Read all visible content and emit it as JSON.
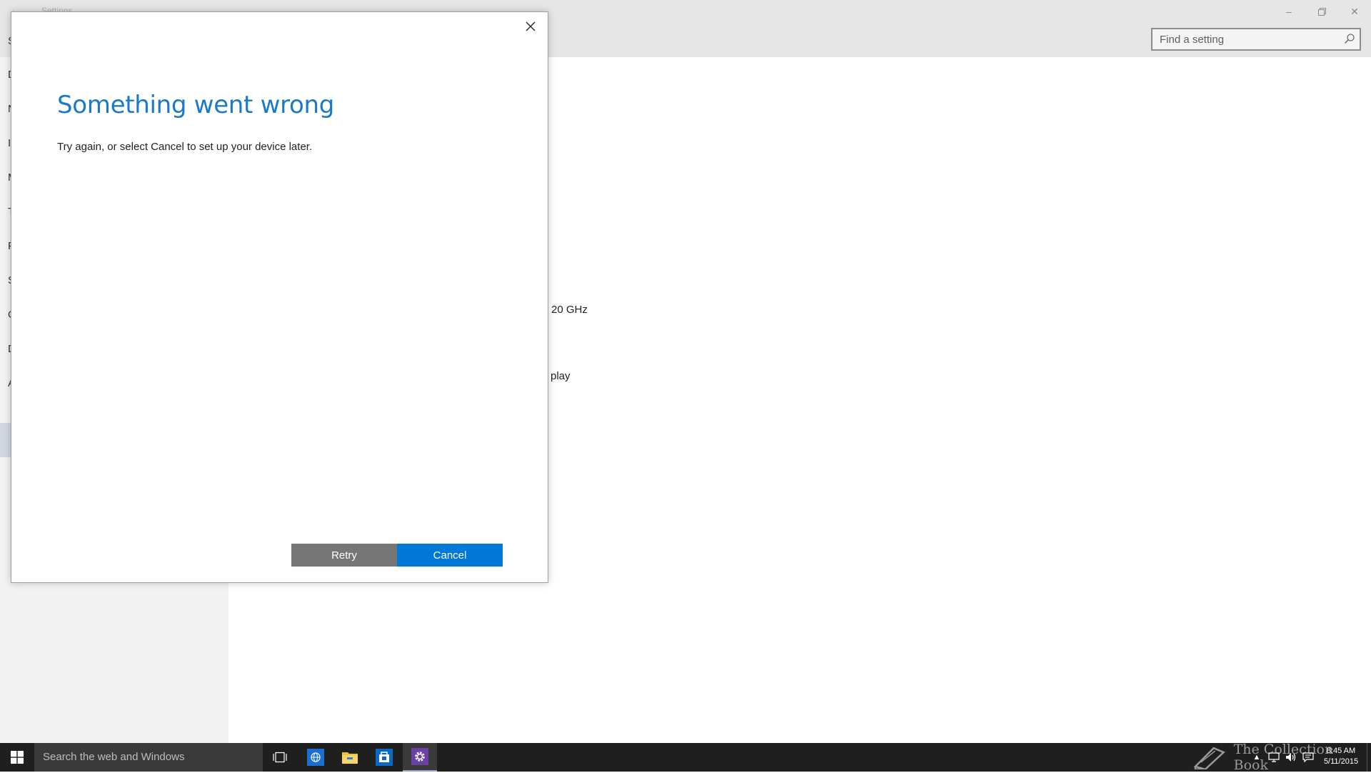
{
  "window": {
    "title": "Settings",
    "search": {
      "placeholder": "Find a setting"
    },
    "sidebar_letters": [
      "S",
      "D",
      "N",
      "I",
      "M",
      "T",
      "P",
      "S",
      "O",
      "D",
      "A"
    ],
    "content_fragments": [
      "20 GHz",
      "play"
    ]
  },
  "dialog": {
    "title": "Something went wrong",
    "message": "Try again, or select Cancel to set up your device later.",
    "retry_label": "Retry",
    "cancel_label": "Cancel"
  },
  "taskbar": {
    "search_placeholder": "Search the web and Windows",
    "watermark": "The Collection Book",
    "time": "8:45 AM",
    "date": "5/11/2015"
  },
  "colors": {
    "accent": "#0078d7",
    "title_blue": "#1979ca",
    "retry_gray": "#767676",
    "taskbar": "#1f1f1f"
  },
  "icons": [
    "back-icon",
    "minimize-icon",
    "restore-icon",
    "close-icon",
    "search-icon",
    "windows-start-icon",
    "task-view-icon",
    "edge-icon",
    "file-explorer-icon",
    "store-icon",
    "settings-gear-icon",
    "book-icon",
    "chevron-up-icon",
    "network-icon",
    "volume-icon",
    "action-center-icon"
  ]
}
